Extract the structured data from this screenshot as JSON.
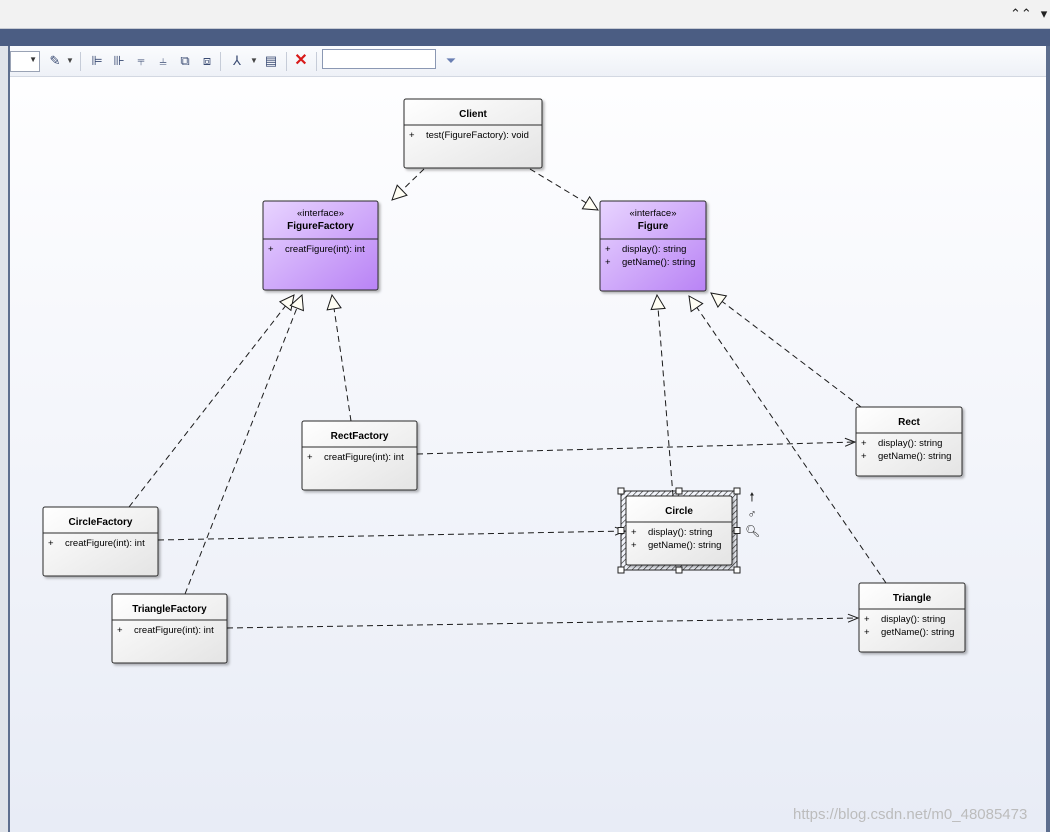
{
  "window": {
    "collapse_glyph": "⌃⌃",
    "menu_glyph": "▾"
  },
  "toolbar": {
    "filter_value": "",
    "icons": [
      "dropdown-combo",
      "edit-style-icon",
      "align-left-icon",
      "align-right-icon",
      "align-top-icon",
      "align-bottom-icon",
      "bring-forward-icon",
      "send-backward-icon",
      "layout-tree-icon",
      "properties-icon",
      "delete-icon",
      "filter-funnel-icon"
    ]
  },
  "diagram": {
    "classes": [
      {
        "id": "client",
        "name": "Client",
        "stereotype": "",
        "interface": false,
        "members": [
          "test(FigureFactory): void"
        ]
      },
      {
        "id": "figurefactory",
        "name": "FigureFactory",
        "stereotype": "«interface»",
        "interface": true,
        "members": [
          "creatFigure(int): int"
        ]
      },
      {
        "id": "figure",
        "name": "Figure",
        "stereotype": "«interface»",
        "interface": true,
        "members": [
          "display(): string",
          "getName(): string"
        ]
      },
      {
        "id": "rectfactory",
        "name": "RectFactory",
        "stereotype": "",
        "interface": false,
        "members": [
          "creatFigure(int): int"
        ]
      },
      {
        "id": "rect",
        "name": "Rect",
        "stereotype": "",
        "interface": false,
        "members": [
          "display(): string",
          "getName(): string"
        ]
      },
      {
        "id": "circlefactory",
        "name": "CircleFactory",
        "stereotype": "",
        "interface": false,
        "members": [
          "creatFigure(int): int"
        ]
      },
      {
        "id": "circle",
        "name": "Circle",
        "stereotype": "",
        "interface": false,
        "selected": true,
        "members": [
          "display(): string",
          "getName(): string"
        ]
      },
      {
        "id": "trianglefactory",
        "name": "TriangleFactory",
        "stereotype": "",
        "interface": false,
        "members": [
          "creatFigure(int): int"
        ]
      },
      {
        "id": "triangle",
        "name": "Triangle",
        "stereotype": "",
        "interface": false,
        "members": [
          "display(): string",
          "getName(): string"
        ]
      }
    ],
    "visibility_marker": "+",
    "relations": [
      {
        "from": "client",
        "to": "figurefactory",
        "kind": "realization"
      },
      {
        "from": "client",
        "to": "figure",
        "kind": "realization"
      },
      {
        "from": "circlefactory",
        "to": "figurefactory",
        "kind": "realization"
      },
      {
        "from": "trianglefactory",
        "to": "figurefactory",
        "kind": "realization"
      },
      {
        "from": "rectfactory",
        "to": "figurefactory",
        "kind": "realization"
      },
      {
        "from": "circle",
        "to": "figure",
        "kind": "realization"
      },
      {
        "from": "triangle",
        "to": "figure",
        "kind": "realization"
      },
      {
        "from": "rect",
        "to": "figure",
        "kind": "realization"
      },
      {
        "from": "rectfactory",
        "to": "rect",
        "kind": "dependency"
      },
      {
        "from": "circlefactory",
        "to": "circle",
        "kind": "dependency"
      },
      {
        "from": "trianglefactory",
        "to": "triangle",
        "kind": "dependency"
      }
    ],
    "selection_handles": [
      "move-up-icon",
      "link-icon",
      "zoom-icon"
    ]
  },
  "colors": {
    "interface_fill_start": "#e8d4ff",
    "interface_fill_end": "#b983f5",
    "class_fill_start": "#ffffff",
    "class_fill_end": "#e6e6e6",
    "border": "#2b2b2b",
    "titlestrip": "#4b5d83"
  },
  "watermark": "https://blog.csdn.net/m0_48085473"
}
